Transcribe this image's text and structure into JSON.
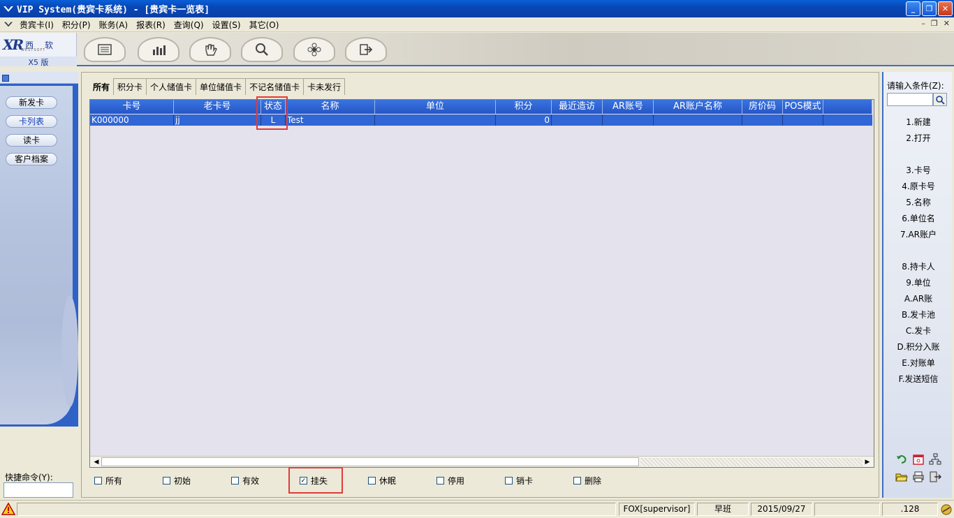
{
  "window": {
    "title": "VIP System(贵宾卡系统) - [贵宾卡一览表]"
  },
  "menu": {
    "items": [
      "贵宾卡(I)",
      "积分(P)",
      "账务(A)",
      "报表(R)",
      "查询(Q)",
      "设置(S)",
      "其它(O)"
    ]
  },
  "brand": {
    "logo_mark": "XR",
    "logo_text": "西 软",
    "logo_sub": "WESTSOFT",
    "version": "X5 版"
  },
  "toolbar": {
    "icons": [
      "list-icon",
      "chart-icon",
      "hand-icon",
      "search-icon",
      "flower-icon",
      "exit-icon"
    ]
  },
  "leftnav": {
    "items": [
      "新发卡",
      "卡列表",
      "读卡",
      "客户档案"
    ],
    "active_index": 1,
    "quick_command_label": "快捷命令(Y):"
  },
  "tabs": [
    "所有",
    "积分卡",
    "个人储值卡",
    "单位储值卡",
    "不记名储值卡",
    "卡未发行"
  ],
  "grid": {
    "columns": [
      "卡号",
      "老卡号",
      "状态",
      "名称",
      "单位",
      "积分",
      "最近造访",
      "AR账号",
      "AR账户名称",
      "房价码",
      "POS模式"
    ],
    "rows": [
      [
        "K000000",
        "jj",
        "L",
        "Test",
        "",
        "0",
        "",
        "",
        "",
        "",
        ""
      ]
    ]
  },
  "filters": [
    {
      "label": "所有",
      "checked": false
    },
    {
      "label": "初始",
      "checked": false
    },
    {
      "label": "有效",
      "checked": false
    },
    {
      "label": "挂失",
      "checked": true
    },
    {
      "label": "休眠",
      "checked": false
    },
    {
      "label": "停用",
      "checked": false
    },
    {
      "label": "销卡",
      "checked": false
    },
    {
      "label": "删除",
      "checked": false
    }
  ],
  "rightpanel": {
    "search_label": "请输入条件(Z):",
    "actions_a": [
      "1.新建",
      "2.打开"
    ],
    "actions_b": [
      "3.卡号",
      "4.原卡号",
      "5.名称",
      "6.单位名",
      "7.AR账户"
    ],
    "actions_c": [
      "8.持卡人",
      "9.单位",
      "A.AR账",
      "B.发卡池",
      "C.发卡",
      "D.积分入账",
      "E.对账单",
      "F.发送短信"
    ]
  },
  "status": {
    "user": "FOX[supervisor]",
    "shift": "早班",
    "date": "2015/09/27",
    "ip": ".128"
  },
  "colors": {
    "header_blue": "#2656c5",
    "selection_blue": "#3166d6",
    "highlight_red": "#e03a3a"
  }
}
